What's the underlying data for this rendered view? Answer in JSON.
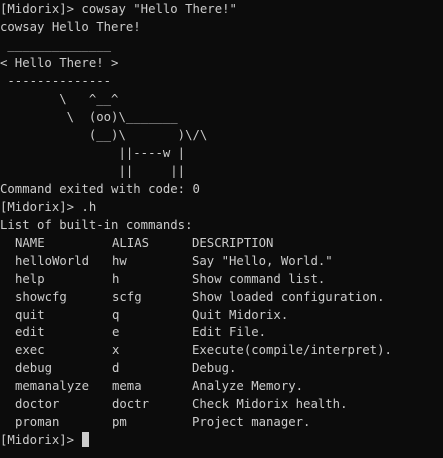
{
  "terminal": {
    "lines_top": [
      "[Midorix]> cowsay \"Hello There!\"",
      "cowsay Hello There!",
      " ______________",
      "< Hello There! >",
      " --------------",
      "        \\   ^__^",
      "         \\  (oo)\\_______",
      "            (__)\\       )\\/\\",
      "                ||----w |",
      "                ||     ||",
      "Command exited with code: 0",
      "[Midorix]> .h",
      "List of built-in commands:"
    ],
    "table_header": {
      "name": "NAME",
      "alias": "ALIAS",
      "description": "DESCRIPTION"
    },
    "commands": [
      {
        "name": "helloWorld",
        "alias": "hw",
        "description": "Say \"Hello, World.\""
      },
      {
        "name": "help",
        "alias": "h",
        "description": "Show command list."
      },
      {
        "name": "showcfg",
        "alias": "scfg",
        "description": "Show loaded configuration."
      },
      {
        "name": "quit",
        "alias": "q",
        "description": "Quit Midorix."
      },
      {
        "name": "edit",
        "alias": "e",
        "description": "Edit File."
      },
      {
        "name": "exec",
        "alias": "x",
        "description": "Execute(compile/interpret)."
      },
      {
        "name": "debug",
        "alias": "d",
        "description": "Debug."
      },
      {
        "name": "memanalyze",
        "alias": "mema",
        "description": "Analyze Memory."
      },
      {
        "name": "doctor",
        "alias": "doctr",
        "description": "Check Midorix health."
      },
      {
        "name": "proman",
        "alias": "pm",
        "description": "Project manager."
      }
    ],
    "prompt": "[Midorix]> "
  }
}
